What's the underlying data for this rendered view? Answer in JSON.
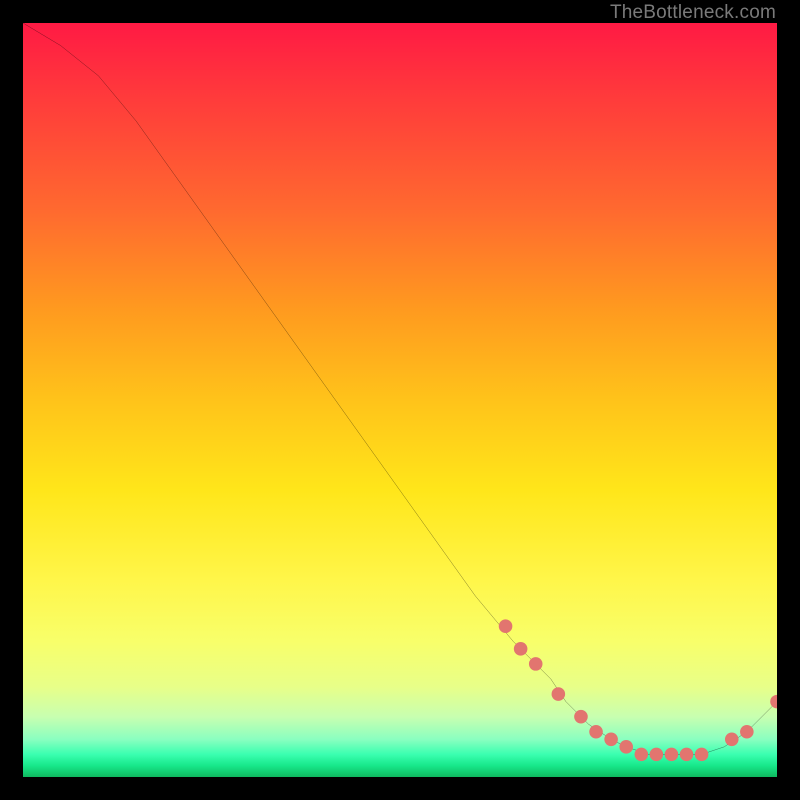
{
  "attribution": "TheBottleneck.com",
  "chart_data": {
    "type": "line",
    "title": "",
    "xlabel": "",
    "ylabel": "",
    "xlim": [
      0,
      100
    ],
    "ylim": [
      0,
      100
    ],
    "x": [
      0,
      5,
      10,
      15,
      20,
      25,
      30,
      35,
      40,
      45,
      50,
      55,
      60,
      65,
      70,
      72,
      75,
      78,
      80,
      83,
      85,
      88,
      90,
      93,
      96,
      100
    ],
    "y": [
      100,
      97,
      93,
      87,
      80,
      73,
      66,
      59,
      52,
      45,
      38,
      31,
      24,
      18,
      13,
      10,
      7,
      5,
      4,
      3,
      3,
      3,
      3,
      4,
      6,
      10
    ],
    "markers": {
      "x": [
        64,
        66,
        68,
        71,
        74,
        76,
        78,
        80,
        82,
        84,
        86,
        88,
        90,
        94,
        96,
        100
      ],
      "y": [
        20,
        17,
        15,
        11,
        8,
        6,
        5,
        4,
        3,
        3,
        3,
        3,
        3,
        5,
        6,
        10
      ]
    },
    "marker_color": "#e2756f",
    "line_color": "#000000"
  }
}
